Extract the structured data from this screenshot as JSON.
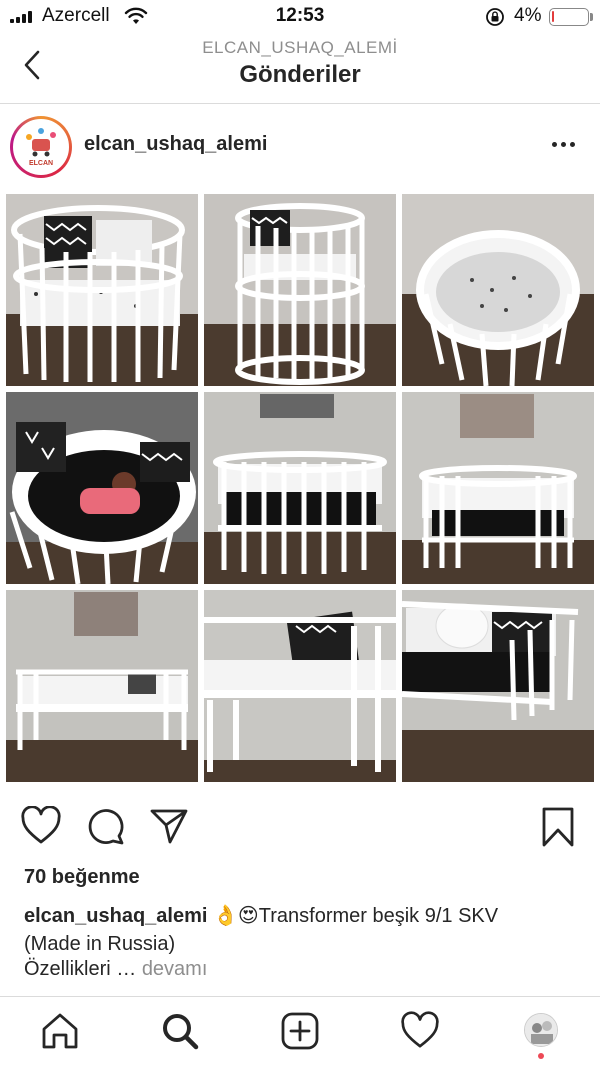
{
  "status_bar": {
    "carrier": "Azercell",
    "time": "12:53",
    "battery_percent": "4%",
    "battery_level": 0.04,
    "icons": [
      "signal-icon",
      "wifi-icon",
      "rotation-lock-icon",
      "battery-icon"
    ]
  },
  "nav": {
    "subtitle": "ELCAN_USHAQ_ALEMİ",
    "title": "Gönderiler",
    "back_icon": "chevron-left-icon"
  },
  "post": {
    "username": "elcan_ushaq_alemi",
    "avatar_logo_text": "ELCAN",
    "more_icon": "more-horizontal-icon",
    "images": [
      "round-crib-front",
      "round-crib-side",
      "round-crib-top",
      "oval-crib-with-baby",
      "oval-crib-front",
      "oval-crib-bumpers",
      "sofa-bed",
      "junior-bed",
      "bed-with-pillow"
    ],
    "likes": "70 beğenme",
    "caption_username": "elcan_ushaq_alemi",
    "caption_emojis": "👌😍",
    "caption_text": "Transformer beşik 9/1 SKV",
    "caption_line2": "(Made in Russia)",
    "more_text": "Özellikleri …",
    "more_link": "devamı"
  },
  "actions": {
    "icons": [
      "heart-icon",
      "comment-icon",
      "share-icon",
      "bookmark-icon"
    ]
  },
  "tabbar": {
    "icons": [
      "home-icon",
      "search-icon",
      "add-post-icon",
      "activity-heart-icon",
      "profile-avatar-icon"
    ]
  },
  "colors": {
    "text": "#262626",
    "secondary": "#8e8e8e",
    "divider": "#dbdbdb",
    "battery_low": "#e23c3c",
    "notification": "#ed4956"
  }
}
